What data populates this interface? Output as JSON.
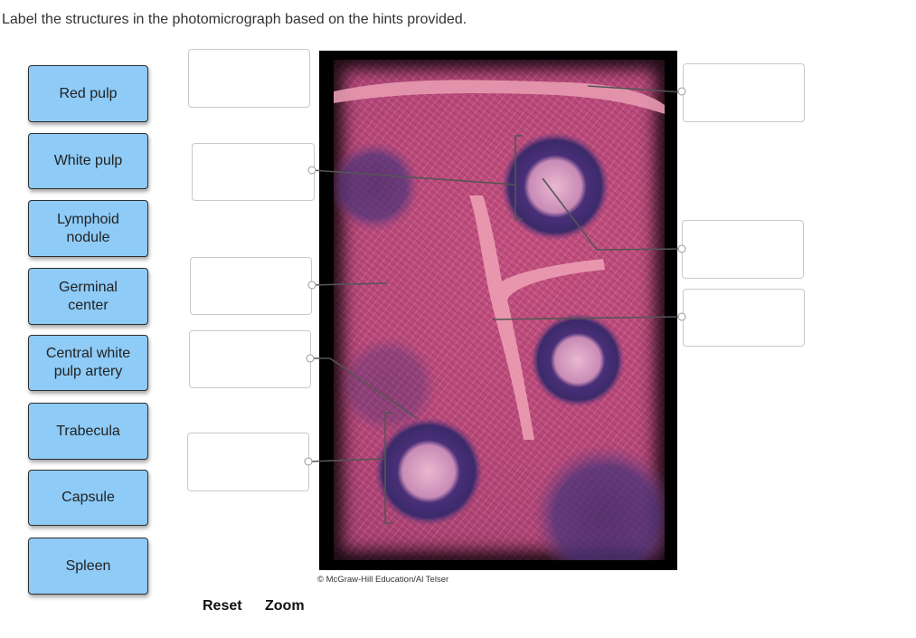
{
  "instructions": "Label the structures in the photomicrograph based on the hints provided.",
  "labels": [
    {
      "text": "Red pulp"
    },
    {
      "text": "White pulp"
    },
    {
      "text": "Lymphoid\nnodule"
    },
    {
      "text": "Germinal\ncenter"
    },
    {
      "text": "Central white\npulp artery"
    },
    {
      "text": "Trabecula"
    },
    {
      "text": "Capsule"
    },
    {
      "text": "Spleen"
    }
  ],
  "figure": {
    "credit": "© McGraw-Hill Education/Al Telser",
    "colors": {
      "tissue_pink": "#c3517f",
      "nodule_purple": "#3c2b6b",
      "trabecula_pink": "#e88fa7"
    }
  },
  "controls": {
    "reset": "Reset",
    "zoom": "Zoom"
  }
}
